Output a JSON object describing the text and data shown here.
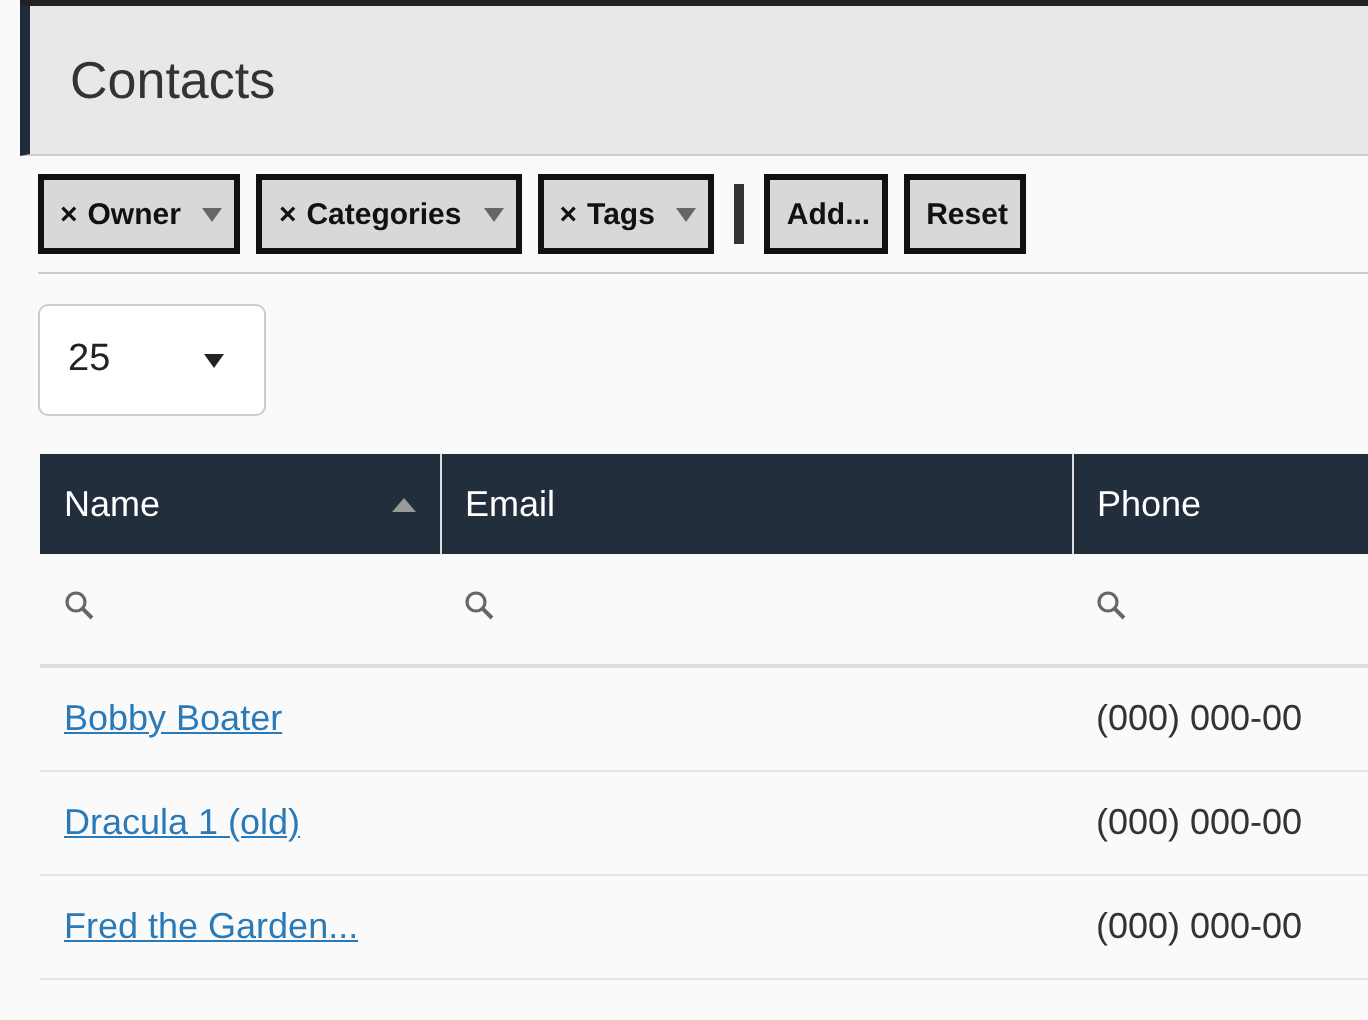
{
  "page_title": "Contacts",
  "filters": [
    {
      "kind": "filter",
      "remove": "×",
      "label": "Owner"
    },
    {
      "kind": "filter",
      "remove": "×",
      "label": "Categories"
    },
    {
      "kind": "filter",
      "remove": "×",
      "label": "Tags"
    },
    {
      "kind": "separator"
    },
    {
      "kind": "action",
      "label": "Add..."
    },
    {
      "kind": "action",
      "label": "Reset"
    }
  ],
  "page_size": {
    "value": "25"
  },
  "table": {
    "columns": [
      {
        "label": "Name",
        "sorted": true
      },
      {
        "label": "Email",
        "sorted": false
      },
      {
        "label": "Phone",
        "sorted": false
      }
    ],
    "rows": [
      {
        "name": "Bobby Boater",
        "email": "",
        "phone": "(000) 000-00"
      },
      {
        "name": "Dracula 1 (old)",
        "email": "",
        "phone": "(000) 000-00"
      },
      {
        "name": "Fred the Garden...",
        "email": "",
        "phone": "(000) 000-00"
      }
    ]
  }
}
